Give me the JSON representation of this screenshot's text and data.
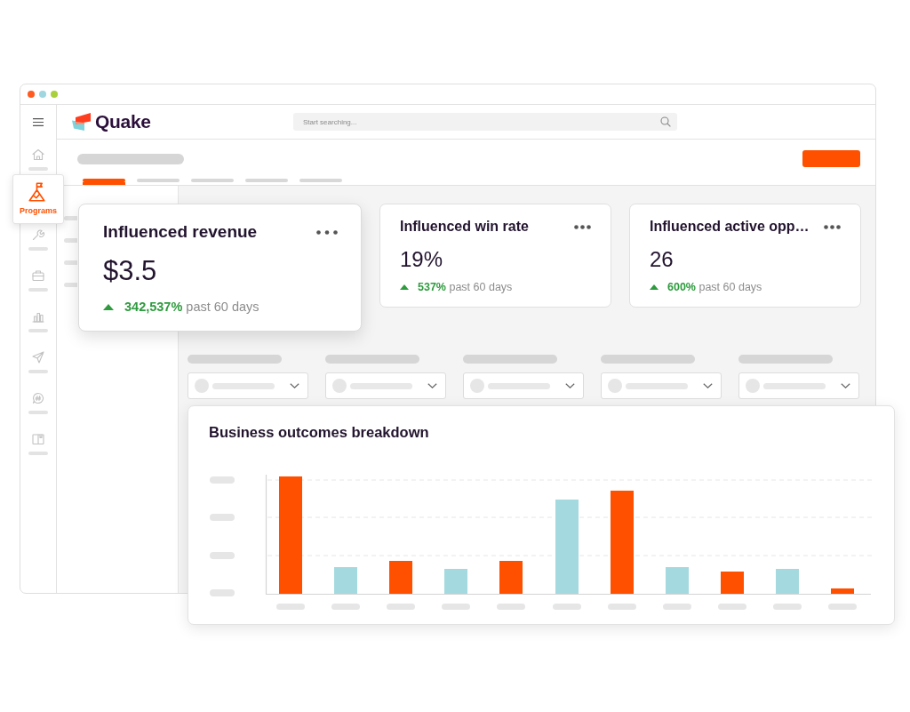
{
  "header": {
    "logo_text": "Quake",
    "search": {
      "placeholder": "Start searching..."
    }
  },
  "sidebar": {
    "items": [
      {
        "selected": false
      },
      {
        "label": "Programs",
        "selected": true
      },
      {
        "selected": false
      },
      {
        "selected": false
      },
      {
        "selected": false
      },
      {
        "selected": false
      },
      {
        "selected": false
      },
      {
        "selected": false
      }
    ]
  },
  "page_header": {
    "tabs": [
      {
        "selected": true
      },
      {
        "selected": false
      },
      {
        "selected": false
      },
      {
        "selected": false
      },
      {
        "selected": false
      }
    ]
  },
  "metric_cards": [
    {
      "kind": "featured",
      "title": "Influenced revenue",
      "value": "$3.5",
      "change": "342,537%",
      "period": "past 60 days"
    },
    {
      "kind": "standard",
      "title": "Influenced win rate",
      "value": "19%",
      "change": "537%",
      "period": "past 60 days"
    },
    {
      "kind": "standard",
      "title": "Influenced active opp…",
      "value": "26",
      "change": "600%",
      "period": "past 60 days"
    }
  ],
  "chart": {
    "title": "Business outcomes breakdown"
  }
}
